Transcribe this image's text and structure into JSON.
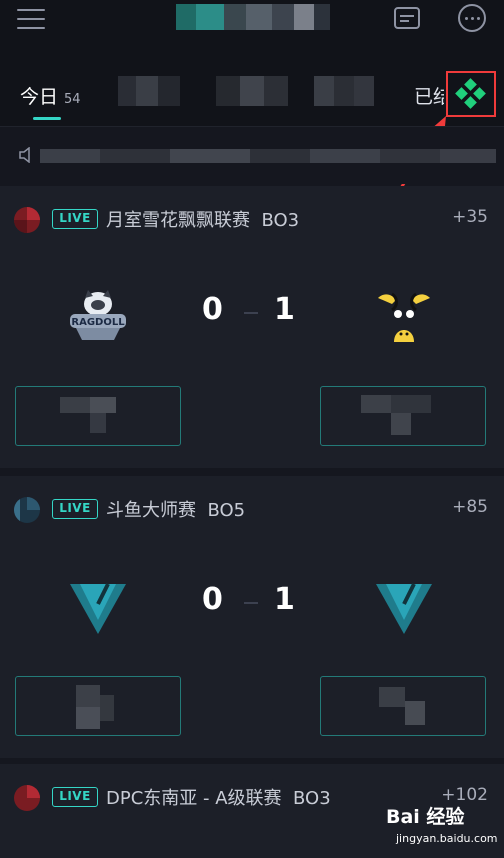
{
  "header": {
    "menu_icon": "menu-icon",
    "notes_icon": "notes-icon",
    "chat_icon": "chat-bubble-icon"
  },
  "tabs": {
    "today": {
      "label": "今日",
      "count": "54"
    },
    "done_label": "已结",
    "filter_icon": "diamond-filter-icon",
    "accent": "#35d6c6",
    "filter_color": "#20d07c",
    "highlight_color": "#f03b3b"
  },
  "notice": {
    "icon": "speaker-icon"
  },
  "matches": [
    {
      "live": "LIVE",
      "league": "月室雪花飘飘联赛",
      "bo": "BO3",
      "plus": "+35",
      "score_left": "0",
      "score_right": "1",
      "team_left": "ragdoll-logo",
      "team_right": "ghost-team-logo",
      "RAGDOLL": "RAGDOLL"
    },
    {
      "live": "LIVE",
      "league": "斗鱼大师赛",
      "bo": "BO5",
      "plus": "+85",
      "score_left": "0",
      "score_right": "1",
      "team_left": "v-shield-logo",
      "team_right": "v-shield-logo"
    },
    {
      "live": "LIVE",
      "league": "DPC东南亚 - A级联赛",
      "bo": "BO3",
      "plus": "+102"
    }
  ],
  "watermark": {
    "main": "Bai 经验",
    "sub": "jingyan.baidu.com"
  }
}
